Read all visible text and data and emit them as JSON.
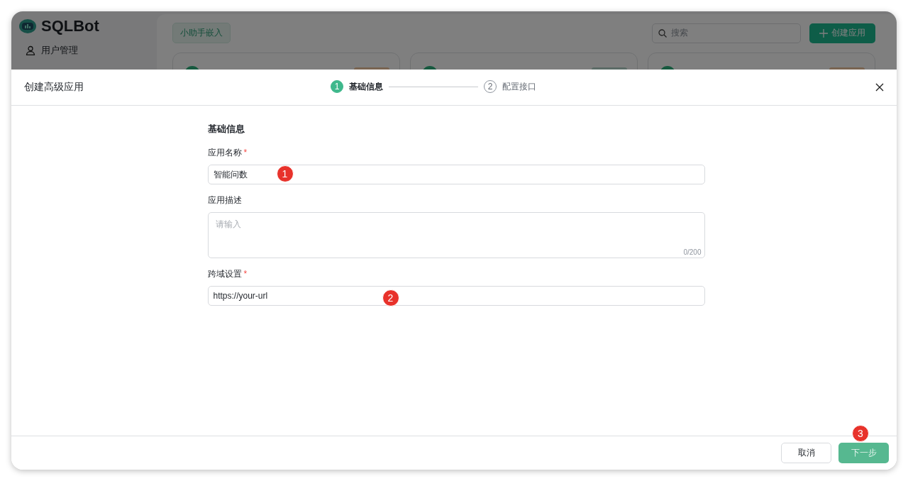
{
  "app": {
    "logo": "SQLBot",
    "sidebar": {
      "items": [
        {
          "label": "用户管理"
        }
      ]
    },
    "tag": "小助手嵌入",
    "search": {
      "placeholder": "搜索"
    },
    "create_button": "创建应用"
  },
  "drawer": {
    "title": "创建高级应用",
    "steps": [
      {
        "number": "1",
        "label": "基础信息",
        "selected": true
      },
      {
        "number": "2",
        "label": "配置接口",
        "selected": false
      }
    ],
    "section_title": "基础信息",
    "fields": [
      {
        "kind": "input",
        "label": "应用名称",
        "required_mark": "*",
        "value": "智能问数",
        "annotation": "1"
      },
      {
        "kind": "textarea",
        "label": "应用描述",
        "placeholder": "请输入",
        "counter": "0/200"
      },
      {
        "kind": "input",
        "label": "跨域设置",
        "required_mark": "*",
        "value": "https://your-url",
        "annotation": "2"
      }
    ],
    "buttons": [
      {
        "label": "取消",
        "kind": "secondary"
      },
      {
        "label": "下一步",
        "kind": "primary",
        "annotation": "3"
      }
    ]
  }
}
